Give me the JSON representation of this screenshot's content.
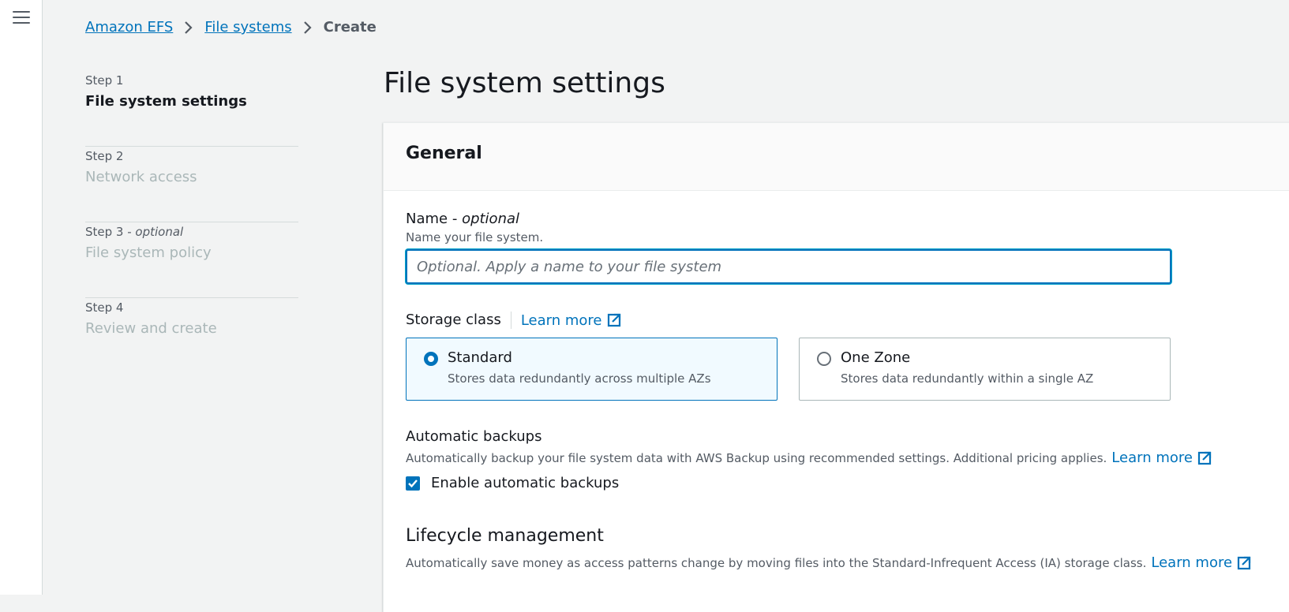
{
  "nav": {
    "menu_icon": "hamburger-menu-icon"
  },
  "breadcrumb": {
    "items": [
      "Amazon EFS",
      "File systems"
    ],
    "current": "Create"
  },
  "steps": [
    {
      "num": "Step 1",
      "optional": "",
      "title": "File system settings",
      "active": true
    },
    {
      "num": "Step 2",
      "optional": "",
      "title": "Network access",
      "active": false
    },
    {
      "num": "Step 3",
      "optional": "optional",
      "title": "File system policy",
      "active": false
    },
    {
      "num": "Step 4",
      "optional": "",
      "title": "Review and create",
      "active": false
    }
  ],
  "page": {
    "title": "File system settings"
  },
  "general": {
    "heading": "General",
    "name": {
      "label": "Name",
      "label_suffix": "optional",
      "description": "Name your file system.",
      "value": "",
      "placeholder": "Optional. Apply a name to your file system"
    },
    "storage_class": {
      "label": "Storage class",
      "learn_more": "Learn more",
      "options": [
        {
          "title": "Standard",
          "description": "Stores data redundantly across multiple AZs",
          "selected": true
        },
        {
          "title": "One Zone",
          "description": "Stores data redundantly within a single AZ",
          "selected": false
        }
      ]
    },
    "backups": {
      "label": "Automatic backups",
      "description": "Automatically backup your file system data with AWS Backup using recommended settings. Additional pricing applies.",
      "learn_more": "Learn more",
      "checkbox_label": "Enable automatic backups",
      "checked": true
    },
    "lifecycle": {
      "heading": "Lifecycle management",
      "description": "Automatically save money as access patterns change by moving files into the Standard-Infrequent Access (IA) storage class.",
      "learn_more": "Learn more"
    }
  },
  "colors": {
    "link": "#0073bb",
    "selected_tile_bg": "#f1faff",
    "page_bg": "#f2f3f3"
  }
}
